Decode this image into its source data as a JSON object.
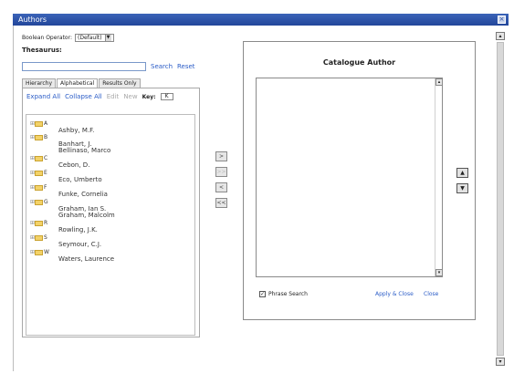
{
  "window": {
    "title": "Authors"
  },
  "boolean_operator": {
    "label": "Boolean Operator:",
    "value": "(Default)"
  },
  "thesaurus": {
    "label": "Thesaurus:",
    "input_value": "",
    "search_label": "Search",
    "reset_label": "Reset"
  },
  "tabs": [
    {
      "label": "Hierarchy"
    },
    {
      "label": "Alphabetical"
    },
    {
      "label": "Results Only"
    }
  ],
  "tree_toolbar": {
    "expand_all": "Expand All",
    "collapse_all": "Collapse All",
    "edit": "Edit",
    "new": "New",
    "key_label": "Key:",
    "key_value": "K"
  },
  "tree": {
    "folders": [
      "A",
      "B",
      "C",
      "E",
      "F",
      "G",
      "R",
      "S",
      "W"
    ],
    "entries": [
      "Ashby, M.F.",
      "Banhart, J.",
      "Bellinaso, Marco",
      "Cebon, D.",
      "Eco, Umberto",
      "Funke, Cornelia",
      "Graham, Ian S.",
      "Graham, Malcolm",
      "Rowling, J.K.",
      "Seymour, C.J.",
      "Waters, Laurence"
    ]
  },
  "transfer_buttons": [
    ">",
    ">>",
    "<",
    "<<"
  ],
  "author_panel": {
    "title": "Catalogue Author",
    "phrase_search_label": "Phrase Search",
    "phrase_search_checked": true,
    "apply_close_label": "Apply & Close",
    "close_label": "Close"
  },
  "icons": {
    "up": "up-arrow-icon",
    "down": "down-arrow-icon",
    "folder": "folder-icon"
  },
  "colors": {
    "titlebar": "#22469a",
    "link": "#2a5cc7"
  }
}
